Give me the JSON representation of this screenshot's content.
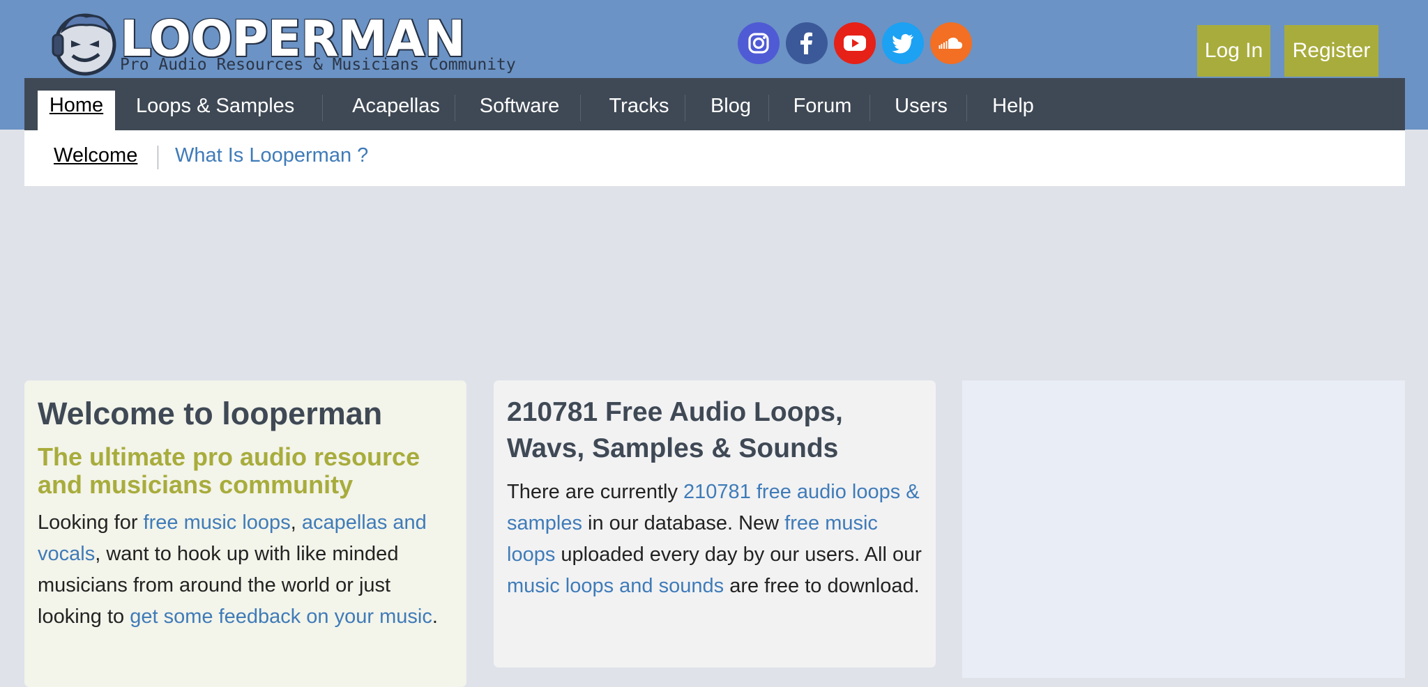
{
  "header": {
    "logo_text": "LOOPERMAN",
    "logo_tagline": "Pro Audio Resources & Musicians Community",
    "social": [
      {
        "icon": "instagram-icon",
        "color": "#4f5bd5"
      },
      {
        "icon": "facebook-icon",
        "color": "#3b5998"
      },
      {
        "icon": "youtube-icon",
        "color": "#e62117"
      },
      {
        "icon": "twitter-icon",
        "color": "#1da1f2"
      },
      {
        "icon": "soundcloud-icon",
        "color": "#f26f23"
      }
    ],
    "login_label": "Log In",
    "register_label": "Register"
  },
  "nav": {
    "items": [
      "Home",
      "Loops & Samples",
      "Acapellas",
      "Software",
      "Tracks",
      "Blog",
      "Forum",
      "Users",
      "Help"
    ],
    "active": "Home"
  },
  "subnav": {
    "welcome": "Welcome",
    "what_is": "What Is Looperman ?"
  },
  "welcome_card": {
    "title": "Welcome to looperman",
    "subtitle": "The ultimate pro audio resource and musicians community",
    "p1": "Looking for ",
    "link1": "free music loops",
    "p2": ", ",
    "link2": "acapellas and vocals",
    "p3": ", want to hook up with like minded musicians from around the world or just looking to ",
    "link3": "get some feedback on your music",
    "p4": "."
  },
  "loops_card": {
    "title": "210781 Free Audio Loops, Wavs, Samples & Sounds",
    "p1": "There are currently ",
    "link1": "210781 free audio loops & samples",
    "p2": " in our database. New ",
    "link2": "free music loops",
    "p3": " uploaded every day by our users. All our ",
    "link3": "music loops and sounds",
    "p4": " are free to download."
  },
  "colors": {
    "header_bg": "#6b93c5",
    "nav_bg": "#3f4955",
    "accent_olive": "#a8ac3c",
    "link": "#3f7bb8"
  }
}
